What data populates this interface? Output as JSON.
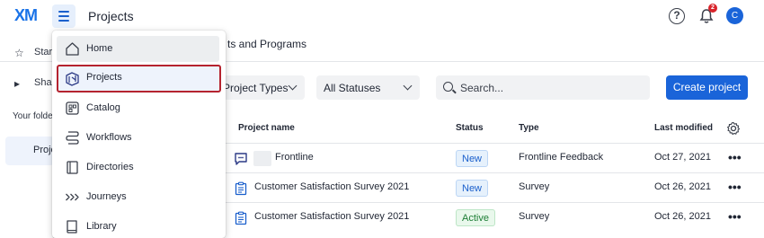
{
  "header": {
    "logo": "XM",
    "title": "Projects",
    "help_symbol": "?",
    "notification_count": "2",
    "avatar_initial": "C"
  },
  "sidebar": {
    "items": [
      {
        "label": "Star",
        "icon": "star-icon"
      },
      {
        "label": "Sha",
        "icon": "caret-right-icon"
      }
    ],
    "section_label": "Your folde",
    "active_item": "Proje"
  },
  "main": {
    "heading": "ts and Programs",
    "filters": [
      {
        "label": "Project Types"
      },
      {
        "label": "All Statuses"
      }
    ],
    "search": {
      "placeholder": "Search..."
    },
    "create_button": "Create project",
    "table": {
      "columns": [
        "Project name",
        "Status",
        "Type",
        "Last modified"
      ],
      "rows": [
        {
          "name": "Frontline",
          "name_redacted": true,
          "status": "New",
          "status_kind": "new",
          "type": "Frontline Feedback",
          "date": "Oct 27, 2021",
          "icon": "frontline-feedback-icon"
        },
        {
          "name": "Customer Satisfaction Survey 2021",
          "name_redacted": false,
          "status": "New",
          "status_kind": "new",
          "type": "Survey",
          "date": "Oct 26, 2021",
          "icon": "survey-icon"
        },
        {
          "name": "Customer Satisfaction Survey 2021",
          "name_redacted": false,
          "status": "Active",
          "status_kind": "active",
          "type": "Survey",
          "date": "Oct 26, 2021",
          "icon": "survey-icon"
        }
      ],
      "more_symbol": "•••"
    }
  },
  "nav_menu": {
    "items": [
      {
        "label": "Home",
        "icon": "home-icon",
        "state": "hover"
      },
      {
        "label": "Projects",
        "icon": "projects-icon",
        "state": "selected"
      },
      {
        "label": "Catalog",
        "icon": "catalog-icon",
        "state": ""
      },
      {
        "label": "Workflows",
        "icon": "workflows-icon",
        "state": ""
      },
      {
        "label": "Directories",
        "icon": "directories-icon",
        "state": ""
      },
      {
        "label": "Journeys",
        "icon": "journeys-icon",
        "state": ""
      },
      {
        "label": "Library",
        "icon": "library-icon",
        "state": ""
      }
    ]
  },
  "colors": {
    "brand_blue": "#1a64d9",
    "selected_outline": "#b5232f",
    "badge_red": "#d8232a"
  }
}
